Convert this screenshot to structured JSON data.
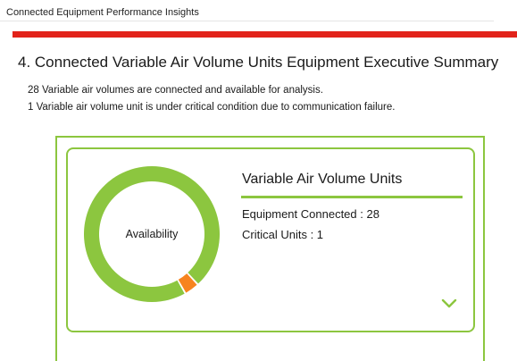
{
  "header": {
    "title": "Connected Equipment Performance Insights"
  },
  "section": {
    "title": "4. Connected Variable Air Volume Units Equipment Executive Summary",
    "lines": [
      "28 Variable air volumes are connected and available for analysis.",
      "1 Variable air volume unit is under critical condition due to communication failure."
    ]
  },
  "card": {
    "title": "Variable Air Volume Units",
    "equipment_connected": "Equipment Connected : 28",
    "critical_units": "Critical Units : 1",
    "donut_label": "Availability"
  },
  "chart_data": {
    "type": "pie",
    "title": "Availability",
    "segments": [
      {
        "value": 27,
        "color": "#8cc63f"
      },
      {
        "value": 1,
        "color": "#f7841f"
      }
    ]
  },
  "colors": {
    "accent_green": "#8cc63f",
    "critical_orange": "#f7841f",
    "brand_red": "#e2231a"
  },
  "icons": {
    "expand": "chevron-down-icon"
  }
}
